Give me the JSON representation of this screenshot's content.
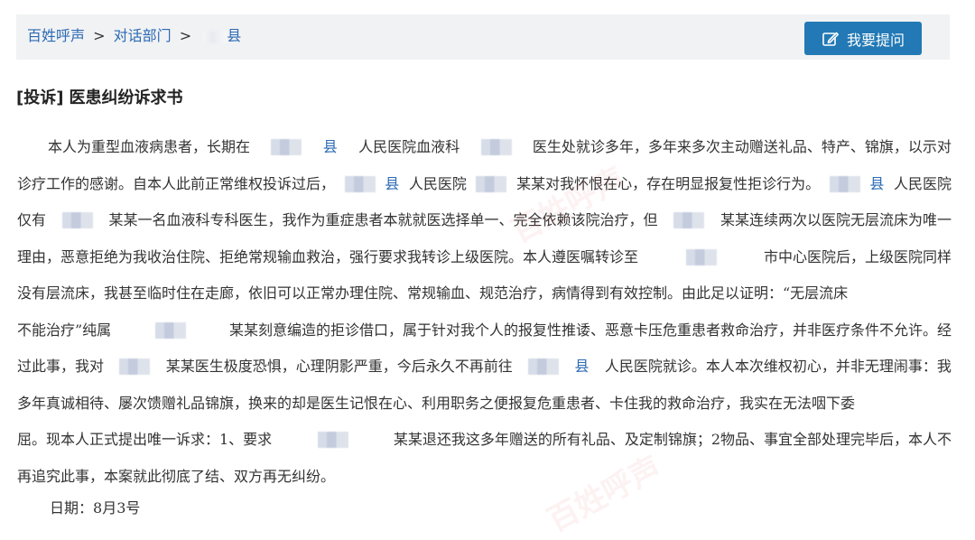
{
  "breadcrumb": {
    "items": [
      "百姓呼声",
      "对话部门"
    ],
    "separator": ">",
    "current_suffix": "县"
  },
  "ask_button": {
    "label": "我要提问",
    "icon": "edit-icon"
  },
  "post": {
    "tag": "[投诉]",
    "title": "医患纠纷诉求书",
    "lines": [
      [
        "本人为重型血液病患者，长期在",
        "[m]",
        "县",
        "人民医院血液科",
        "[m]",
        "医生处就诊多年，多年来多次主动赠送礼品、特产、锦旗，以示对"
      ],
      [
        "诊疗工作的感谢。自本人此前正常维权投诉过后，",
        "[m]",
        "县",
        "人民医院",
        "[m]",
        "某某对我怀恨在心，存在明显报复性拒诊行为。",
        "[m]",
        "县",
        "人民医院"
      ],
      [
        "仅有",
        "[m]",
        "某某一名血液科专科医生，我作为重症患者本就就医选择单一、完全依赖该院治疗，但",
        "[m]",
        "某某连续两次以医院无层流床为唯一"
      ],
      [
        "理由，恶意拒绝为我收治住院、拒绝常规输血救治，强行要求我转诊上级医院。本人遵医嘱转诊至",
        "[m]",
        "市中心医院后，上级医院同样"
      ],
      [
        "没有层流床，我甚至临时住在走廊，依旧可以正常办理住院、常规输血、规范治疗，病情得到有效控制。由此足以证明：“无层流床"
      ],
      [
        "不能治疗”纯属",
        "[m]",
        "某某刻意编造的拒诊借口，属于针对我个人的报复性推诿、恶意卡压危重患者救命治疗，并非医疗条件不允许。经"
      ],
      [
        "过此事，我对",
        "[m]",
        "某某医生极度恐惧，心理阴影严重，今后永久不再前往",
        "[m]",
        "县",
        "人民医院就诊。本人本次维权初心，并非无理闹事：我"
      ],
      [
        "多年真诚相待、屡次馈赠礼品锦旗，换来的却是医生记恨在心、利用职务之便报复危重患者、卡住我的救命治疗，我实在无法咽下委"
      ],
      [
        "屈。现本人正式提出唯一诉求：1、要求",
        "[m]",
        "某某退还我这多年赠送的所有礼品、及定制锦旗；2物品、事宜全部处理完毕后，本人不"
      ],
      [
        "再追究此事，本案就此彻底了结、双方再无纠纷。"
      ]
    ],
    "date_label": "日期：",
    "date_value": "8月3号"
  },
  "colors": {
    "link": "#2c6ab3",
    "button_bg": "#2279b5",
    "topbar_bg": "#f1f2f4",
    "text": "#333333"
  }
}
